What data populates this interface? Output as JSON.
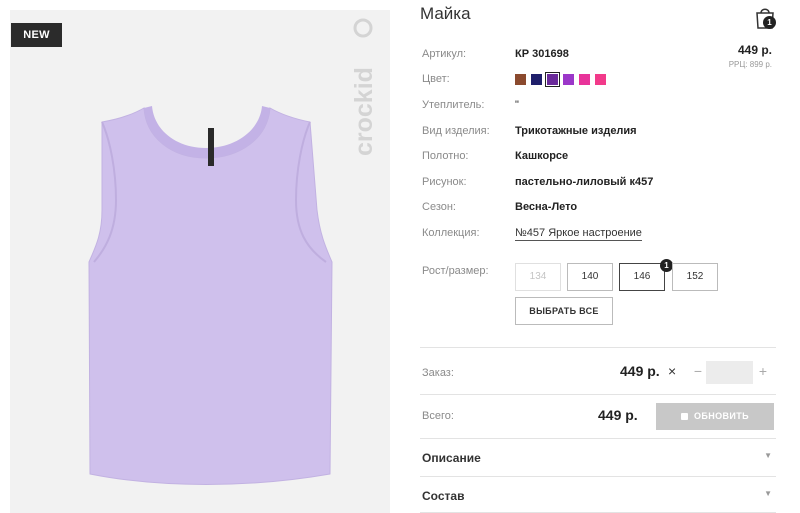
{
  "product_image": {
    "badge": "NEW",
    "brand": "crockid"
  },
  "product": {
    "title": "Майка",
    "price": "449 р.",
    "rrp": "РРЦ: 899 р."
  },
  "cart": {
    "count": "1"
  },
  "details": [
    {
      "label": "Артикул:",
      "value": "КР 301698"
    },
    {
      "label": "Цвет:",
      "value": ""
    },
    {
      "label": "Утеплитель:",
      "value": "\""
    },
    {
      "label": "Вид изделия:",
      "value": "Трикотажные изделия"
    },
    {
      "label": "Полотно:",
      "value": "Кашкорсе"
    },
    {
      "label": "Рисунок:",
      "value": "пастельно-лиловый к457"
    },
    {
      "label": "Сезон:",
      "value": "Весна-Лето"
    },
    {
      "label": "Коллекция:",
      "value": "№457 Яркое настроение"
    }
  ],
  "colors": {
    "swatches": [
      "#8b4a2e",
      "#1f1f6b",
      "#6a2a9a",
      "#9b37c9",
      "#e8339a",
      "#f23a8a"
    ],
    "selected_index": 2
  },
  "sizes": {
    "label": "Рост/размер:",
    "options": [
      {
        "value": "134",
        "state": "disabled"
      },
      {
        "value": "140",
        "state": "available"
      },
      {
        "value": "146",
        "state": "in-cart",
        "count": "1"
      },
      {
        "value": "152",
        "state": "available"
      }
    ],
    "select_all": "ВЫБРАТЬ ВСЕ"
  },
  "order": {
    "label": "Заказ:",
    "price": "449 р.",
    "times": "×",
    "minus": "−",
    "plus": "+",
    "quantity": ""
  },
  "total": {
    "label": "Всего:",
    "price": "449 р.",
    "button": "ОБНОВИТЬ"
  },
  "accordions": [
    {
      "label": "Описание"
    },
    {
      "label": "Состав"
    }
  ]
}
